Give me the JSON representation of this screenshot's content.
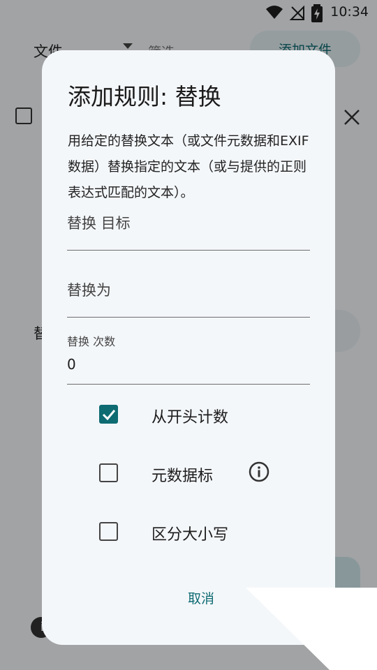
{
  "status_bar": {
    "time": "10:34",
    "icons": [
      "wifi-icon",
      "no-signal-icon",
      "battery-charging-icon"
    ]
  },
  "background": {
    "file_dropdown": "文件",
    "filter": "筛选",
    "add_file_button": "添加文件",
    "replace_label": "替"
  },
  "dialog": {
    "title": "添加规则: 替换",
    "description": "用给定的替换文本（或文件元数据和EXIF数据）替换指定的文本（或与提供的正则表达式匹配的文本）。",
    "fields": {
      "target": {
        "placeholder": "替换 目标",
        "value": ""
      },
      "replacement": {
        "placeholder": "替换为",
        "value": ""
      },
      "count": {
        "label": "替换 次数",
        "value": "0"
      }
    },
    "options": [
      {
        "label": "从开头计数",
        "checked": true
      },
      {
        "label": "元数据标",
        "checked": false,
        "icon": "info-icon"
      },
      {
        "label": "区分大小写",
        "checked": false
      }
    ],
    "cancel_button": "取消"
  },
  "colors": {
    "accent": "#0e6b72",
    "dialog_bg": "#f4f7fa"
  }
}
